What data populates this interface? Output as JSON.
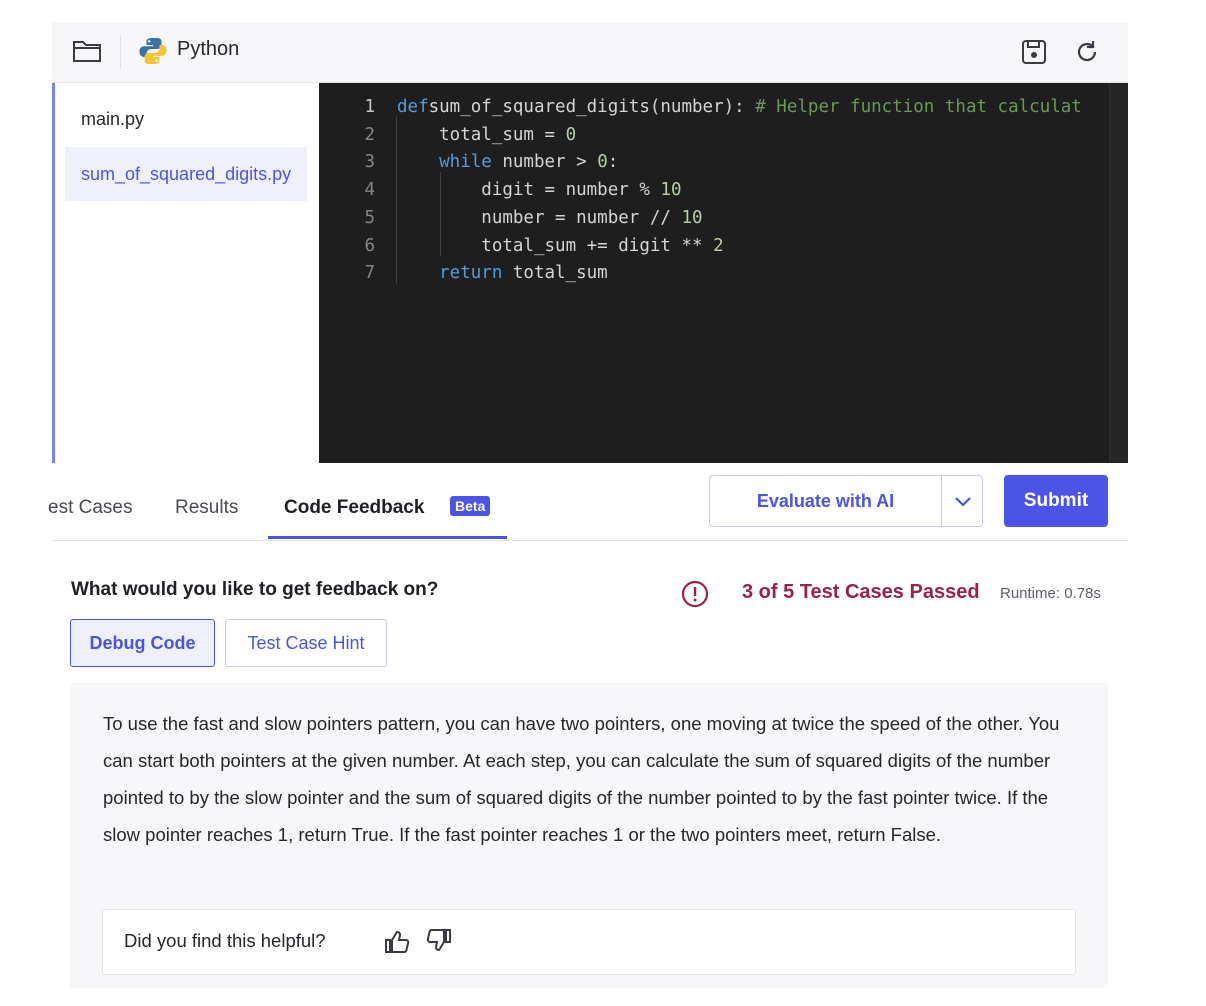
{
  "toolbar": {
    "folder_icon": "folder-icon",
    "language": "Python",
    "language_icon": "python-icon",
    "save_icon": "save-icon",
    "refresh_icon": "refresh-icon"
  },
  "files": [
    {
      "name": "main.py",
      "active": false
    },
    {
      "name": "sum_of_squared_digits.py",
      "active": true
    }
  ],
  "editor": {
    "line_numbers": [
      "1",
      "2",
      "3",
      "4",
      "5",
      "6",
      "7"
    ],
    "lines": [
      {
        "segments": [
          [
            "kw",
            "def"
          ],
          [
            "",
            "sum_of_squared_digits(number): "
          ],
          [
            "cm",
            "# Helper function that calculat"
          ]
        ]
      },
      {
        "segments": [
          [
            "",
            "    total_sum = "
          ],
          [
            "nm",
            "0"
          ]
        ]
      },
      {
        "segments": [
          [
            "kw",
            "    while"
          ],
          [
            "",
            " number > "
          ],
          [
            "nm",
            "0"
          ],
          [
            "",
            ":"
          ]
        ]
      },
      {
        "segments": [
          [
            "",
            "        digit = number % "
          ],
          [
            "nm",
            "10"
          ]
        ]
      },
      {
        "segments": [
          [
            "",
            "        number = number // "
          ],
          [
            "nm",
            "10"
          ]
        ]
      },
      {
        "segments": [
          [
            "",
            "        total_sum += digit ** "
          ],
          [
            "nm",
            "2"
          ]
        ]
      },
      {
        "segments": [
          [
            "kw",
            "    return"
          ],
          [
            "",
            " total_sum"
          ]
        ]
      }
    ]
  },
  "tabs": {
    "test_cases": "est Cases",
    "results": "Results",
    "code_feedback": "Code Feedback",
    "beta": "Beta"
  },
  "actions": {
    "evaluate": "Evaluate with AI",
    "submit": "Submit"
  },
  "feedback": {
    "question": "What would you like to get feedback on?",
    "status": "3 of 5 Test Cases Passed",
    "runtime": "Runtime: 0.78s",
    "debug_code": "Debug Code",
    "test_case_hint": "Test Case Hint",
    "text": "To use the fast and slow pointers pattern, you can have two pointers, one moving at twice the speed of the other. You can start both pointers at the given number. At each step, you can calculate the sum of squared digits of the number pointed to by the slow pointer and the sum of squared digits of the number pointed to by the fast pointer twice. If the slow pointer reaches 1, return True. If the fast pointer reaches 1 or the two pointers meet, return False.",
    "helpful_question": "Did you find this helpful?"
  },
  "colors": {
    "accent": "#4b54e6",
    "status_fail": "#9b2146",
    "editor_bg": "#1e1e1e"
  }
}
